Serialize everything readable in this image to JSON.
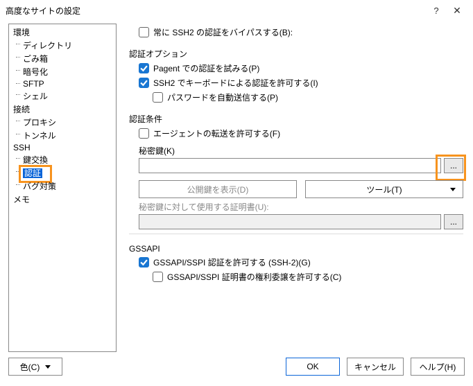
{
  "titlebar": {
    "title": "高度なサイトの設定"
  },
  "tree": {
    "items": [
      {
        "label": "環境",
        "lvl": 1
      },
      {
        "label": "ディレクトリ",
        "lvl": 2
      },
      {
        "label": "ごみ箱",
        "lvl": 2
      },
      {
        "label": "暗号化",
        "lvl": 2
      },
      {
        "label": "SFTP",
        "lvl": 2
      },
      {
        "label": "シェル",
        "lvl": 2
      },
      {
        "label": "接続",
        "lvl": 1
      },
      {
        "label": "プロキシ",
        "lvl": 2
      },
      {
        "label": "トンネル",
        "lvl": 2
      },
      {
        "label": "SSH",
        "lvl": 1
      },
      {
        "label": "鍵交換",
        "lvl": 2
      },
      {
        "label": "認証",
        "lvl": 2,
        "selected": true,
        "highlight": true
      },
      {
        "label": "バグ対策",
        "lvl": 2
      },
      {
        "label": "メモ",
        "lvl": 1
      }
    ]
  },
  "main": {
    "bypass": {
      "label": "常に SSH2 の認証をバイパスする(B):",
      "checked": false
    },
    "auth_options_title": "認証オプション",
    "agent": {
      "label": "Pagent での認証を試みる(P)",
      "checked": true
    },
    "keyboard": {
      "label": "SSH2 でキーボードによる認証を許可する(I)",
      "checked": true
    },
    "autopass": {
      "label": "パスワードを自動送信する(P)",
      "checked": false
    },
    "auth_cond_title": "認証条件",
    "forward": {
      "label": "エージェントの転送を許可する(F)",
      "checked": false
    },
    "private_key_label": "秘密鍵(K)",
    "private_key_value": "",
    "browse_label": "...",
    "show_pubkey": "公開鍵を表示(D)",
    "tools": "ツール(T)",
    "cert_label": "秘密鍵に対して使用する証明書(U):",
    "cert_value": "",
    "gssapi_title": "GSSAPI",
    "gssapi_auth": {
      "label": "GSSAPI/SSPI 認証を許可する (SSH-2)(G)",
      "checked": true
    },
    "gssapi_deleg": {
      "label": "GSSAPI/SSPI 証明書の権利委譲を許可する(C)",
      "checked": false
    }
  },
  "footer": {
    "color": "色(C)",
    "ok": "OK",
    "cancel": "キャンセル",
    "help": "ヘルプ(H)"
  }
}
